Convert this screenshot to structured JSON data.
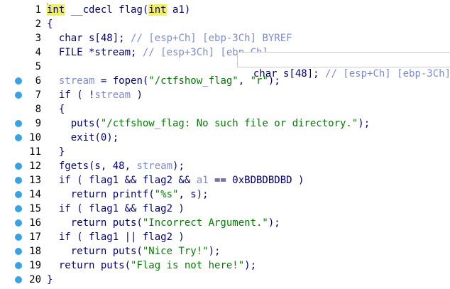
{
  "lines": [
    {
      "n": "1",
      "bp": false,
      "parts": [
        [
          "hl",
          "int"
        ],
        [
          "k",
          " __cdecl flag("
        ],
        [
          "hl",
          "int"
        ],
        [
          "k",
          " a1)"
        ]
      ]
    },
    {
      "n": "2",
      "bp": false,
      "parts": [
        [
          "k",
          "{"
        ]
      ]
    },
    {
      "n": "3",
      "bp": false,
      "parts": [
        [
          "k",
          "  char s[48]; "
        ],
        [
          "c",
          "// [esp+Ch] [ebp-3Ch] BYREF"
        ]
      ]
    },
    {
      "n": "4",
      "bp": false,
      "parts": [
        [
          "k",
          "  FILE *stream; "
        ],
        [
          "c",
          "// [esp+3Ch] [ebp-Ch]"
        ]
      ]
    },
    {
      "n": "5",
      "bp": false,
      "parts": []
    },
    {
      "n": "6",
      "bp": true,
      "parts": [
        [
          "v",
          "  stream"
        ],
        [
          "k",
          " = fopen("
        ],
        [
          "s",
          "\"/ctfshow_flag\""
        ],
        [
          "k",
          ", "
        ],
        [
          "s",
          "\"r\""
        ],
        [
          "k",
          ");"
        ]
      ]
    },
    {
      "n": "7",
      "bp": true,
      "parts": [
        [
          "k",
          "  if ( !"
        ],
        [
          "v",
          "stream"
        ],
        [
          "k",
          " )"
        ]
      ]
    },
    {
      "n": "8",
      "bp": false,
      "parts": [
        [
          "k",
          "  {"
        ]
      ]
    },
    {
      "n": "9",
      "bp": true,
      "parts": [
        [
          "k",
          "    puts("
        ],
        [
          "s",
          "\"/ctfshow_flag: No such file or directory.\""
        ],
        [
          "k",
          ");"
        ]
      ]
    },
    {
      "n": "10",
      "bp": true,
      "parts": [
        [
          "k",
          "    exit(0);"
        ]
      ]
    },
    {
      "n": "11",
      "bp": false,
      "parts": [
        [
          "k",
          "  }"
        ]
      ]
    },
    {
      "n": "12",
      "bp": true,
      "parts": [
        [
          "k",
          "  fgets(s, 48, "
        ],
        [
          "v",
          "stream"
        ],
        [
          "k",
          ");"
        ]
      ]
    },
    {
      "n": "13",
      "bp": true,
      "parts": [
        [
          "k",
          "  if ( flag1 && flag2 && "
        ],
        [
          "v",
          "a1"
        ],
        [
          "k",
          " == 0xBDBDBDBD )"
        ]
      ]
    },
    {
      "n": "14",
      "bp": true,
      "parts": [
        [
          "k",
          "    return printf("
        ],
        [
          "s",
          "\"%s\""
        ],
        [
          "k",
          ", s);"
        ]
      ]
    },
    {
      "n": "15",
      "bp": true,
      "parts": [
        [
          "k",
          "  if ( flag1 && flag2 )"
        ]
      ]
    },
    {
      "n": "16",
      "bp": true,
      "parts": [
        [
          "k",
          "    return puts("
        ],
        [
          "s",
          "\"Incorrect Argument.\""
        ],
        [
          "k",
          ");"
        ]
      ]
    },
    {
      "n": "17",
      "bp": true,
      "parts": [
        [
          "k",
          "  if ( flag1 || flag2 )"
        ]
      ]
    },
    {
      "n": "18",
      "bp": true,
      "parts": [
        [
          "k",
          "    return puts("
        ],
        [
          "s",
          "\"Nice Try!\""
        ],
        [
          "k",
          ");"
        ]
      ]
    },
    {
      "n": "19",
      "bp": true,
      "parts": [
        [
          "k",
          "  return puts("
        ],
        [
          "s",
          "\"Flag is not here!\""
        ],
        [
          "k",
          ");"
        ]
      ]
    },
    {
      "n": "20",
      "bp": true,
      "parts": [
        [
          "k",
          "}"
        ]
      ]
    }
  ],
  "tooltip": {
    "code": "char s[48]; ",
    "comment": "// [esp+Ch] [ebp-3Ch]"
  },
  "colors": {
    "keyword": "#000080",
    "string": "#008000",
    "comment": "#7a8bd6",
    "highlight": "#f2f05a",
    "breakpoint": "#36a3e8"
  }
}
